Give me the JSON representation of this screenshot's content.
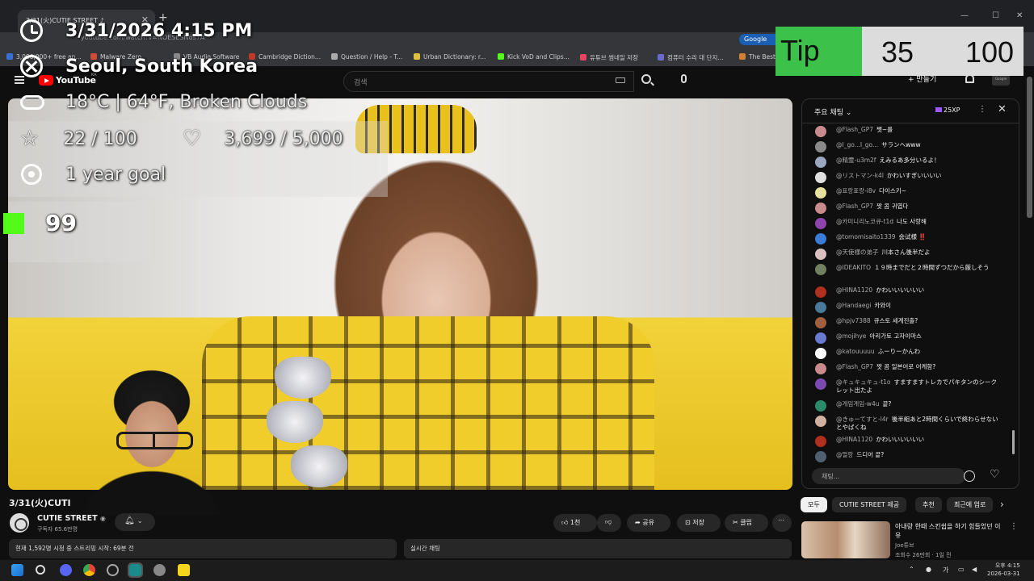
{
  "browser": {
    "tab_title": "3/31(火)CUTIE STREET ♪",
    "url": "youtube.com/watch?v=NOESESN6s7A",
    "google_button": "Google",
    "bookmarks": [
      "3,000,000+ free an...",
      "Malware Zero",
      "VB Audio Software",
      "Cambridge Diction...",
      "Question / Help - T...",
      "Urban Dictionary: r...",
      "Kick VoD and Clips...",
      "유튜브 썸네일 저장",
      "컴퓨터 수리 대 단지...",
      "The Best"
    ]
  },
  "youtube": {
    "logo_text": "YouTube",
    "logo_region": "KR",
    "search_placeholder": "검색",
    "create_label": "+ 만들기",
    "avatar_label": "Google"
  },
  "overlay": {
    "datetime": "3/31/2026 4:15 PM",
    "location": "Seoul, South Korea",
    "weather": "18°C | 64°F, Broken Clouds",
    "star_count": "22 / 100",
    "heart_count": "3,699 / 5,000",
    "goal": "1 year goal",
    "kick_count": "99",
    "tip_label": "Tip",
    "tip_current": "35",
    "tip_target": "100"
  },
  "video_info": {
    "title": "3/31(火)CUTI",
    "channel_name": "CUTIE STREET",
    "subscribers": "구독자 65.6만명",
    "like_label": "1천",
    "share_label": "공유",
    "save_label": "저장",
    "clip_label": "클립",
    "description": "현재 1,592명 시청 중 스트리밍 시작: 69분 전",
    "live_chat_label": "실시간 채팅"
  },
  "chat": {
    "title": "주요 채팅",
    "xp_badge": "25XP",
    "input_placeholder": "채팅...",
    "messages": [
      {
        "author": "@Flash_GP7",
        "text": "쨋~를",
        "color": "#c88a8a"
      },
      {
        "author": "@I_go...I_go...",
        "text": "サランヘwww",
        "color": "#8a8a8a"
      },
      {
        "author": "@精霊-u3m2f",
        "text": "えみるあ多分いるよ！",
        "color": "#9aa7c0"
      },
      {
        "author": "@リストマン-k4l",
        "text": "かわいすぎいいいい",
        "color": "#e0e0e0"
      },
      {
        "author": "@표랑표랑-i8v",
        "text": "다이스키~",
        "color": "#e8e0a0"
      },
      {
        "author": "@Flash_GP7",
        "text": "짯 콤 귀엽다",
        "color": "#c88a8a"
      },
      {
        "author": "@카미니리노코큐-t1d",
        "text": "나도 사랑해",
        "color": "#8e44ad"
      },
      {
        "author": "@tomomisaito1339",
        "text": "会试様 ‼️",
        "color": "#3a7bd5"
      },
      {
        "author": "@天使様の弟子",
        "text": "川本さん後半だよ",
        "color": "#d8c0c0"
      },
      {
        "author": "@IDEAKITO",
        "text": "１９時までだと２時間ずつだから厳しそう",
        "color": "#708060"
      },
      {
        "author": "@HINA1120",
        "text": "かわいいいいいい",
        "color": "#b03020"
      },
      {
        "author": "@Handaegi",
        "text": "카와이",
        "color": "#4a7a9a"
      },
      {
        "author": "@hpjv7388",
        "text": "큐스토 세계진출?",
        "color": "#a06040"
      },
      {
        "author": "@mojihye",
        "text": "아리가토 고자이마스",
        "color": "#6a7ad0"
      },
      {
        "author": "@katouuuuu",
        "text": "ふーりーかんわ",
        "color": "#ffffff"
      },
      {
        "author": "@Flash_GP7",
        "text": "짯 콤 일본어로 어케함?",
        "color": "#c88a8a"
      },
      {
        "author": "@キュキュキュ-t1o",
        "text": "すますますトレカでパキタンのシークレット出たよ",
        "color": "#7a4ab0"
      },
      {
        "author": "@게임게임-w4u",
        "text": "끝?",
        "color": "#2a8a6a"
      },
      {
        "author": "@きゅーてすと-l4r",
        "text": "後半組あと2時間くらいで終わらせないとやばくね",
        "color": "#d0b0a0"
      },
      {
        "author": "@HINA1120",
        "text": "かわいいいいいい",
        "color": "#b03020"
      },
      {
        "author": "@멀랑",
        "text": "드디어 끝?",
        "color": "#506070"
      }
    ]
  },
  "recommendations": {
    "chips": [
      "모두",
      "CUTIE STREET 제공",
      "추천",
      "최근에 업로"
    ],
    "video": {
      "title": "아내랑 한때 스킨쉽을 하기 힘들었던 이유",
      "channel": "Joe튜브",
      "meta": "조회수 26만회 · 1일 전"
    }
  },
  "taskbar": {
    "ime": "가",
    "time": "오후 4:15",
    "date": "2026-03-31"
  }
}
